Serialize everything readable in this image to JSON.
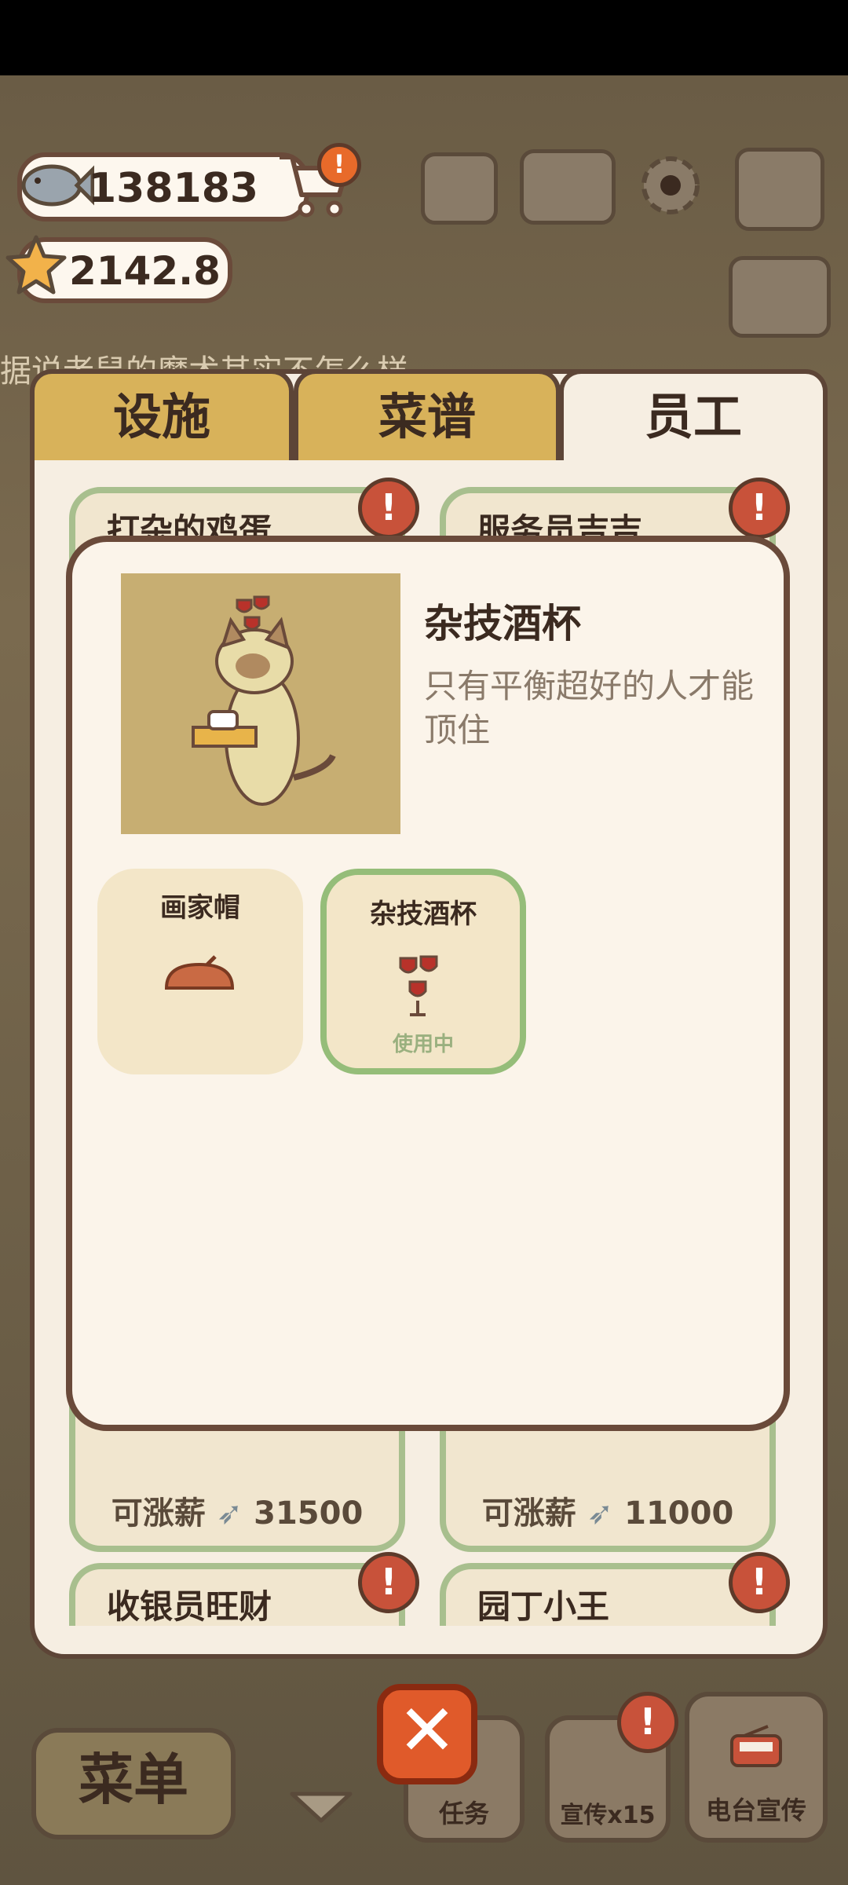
{
  "currency": {
    "fish": "138183",
    "stars": "2142.8"
  },
  "marquee": "据说老鼠的魔术其实不怎么样",
  "tabs": [
    {
      "label": "设施"
    },
    {
      "label": "菜谱"
    },
    {
      "label": "员工"
    }
  ],
  "staff_cards": [
    {
      "name": "打杂的鸡蛋",
      "raise_label": "可涨薪",
      "raise_amount": "31500"
    },
    {
      "name": "服务员吉吉",
      "raise_label": "可涨薪",
      "raise_amount": "11000"
    },
    {
      "name": "收银员旺财"
    },
    {
      "name": "园丁小王"
    }
  ],
  "alert_glyph": "!",
  "modal": {
    "title": "杂技酒杯",
    "description": "只有平衡超好的人才能顶住",
    "options": [
      {
        "label": "画家帽",
        "status": ""
      },
      {
        "label": "杂技酒杯",
        "status": "使用中"
      }
    ]
  },
  "bottom_bar": {
    "menu": "菜单",
    "tasks": "任务",
    "promo": "宣传x15",
    "radio": "电台宣传",
    "close_glyph": "✕"
  },
  "colors": {
    "accent_green": "#95bd79",
    "alert_red": "#c8523a",
    "tab_gold": "#d8b25a"
  }
}
